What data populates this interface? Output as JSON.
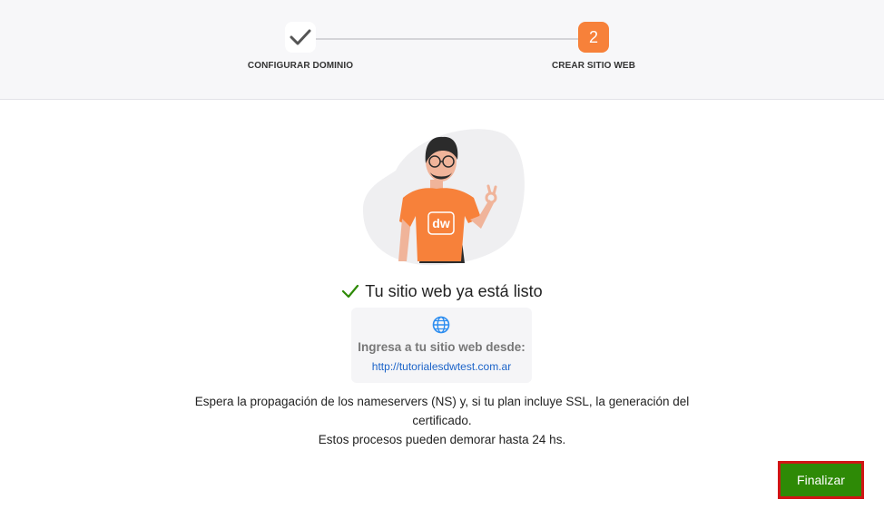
{
  "stepper": {
    "steps": [
      {
        "label": "CONFIGURAR DOMINIO",
        "state": "completed",
        "icon": "check-icon"
      },
      {
        "label": "CREAR SITIO WEB",
        "number": "2",
        "state": "active"
      }
    ],
    "accent_color": "#f7813a"
  },
  "illustration": {
    "shirt_logo": "dw",
    "icon": "developer-character-ok-gesture"
  },
  "success": {
    "title": "Tu sitio web ya está listo",
    "icon": "check-icon",
    "color": "#2e8a06"
  },
  "site_card": {
    "icon": "globe-icon",
    "label": "Ingresa a tu sitio web desde:",
    "url": "http://tutorialesdwtest.com.ar"
  },
  "note": {
    "line1": "Espera la propagación de los nameservers (NS) y, si tu plan incluye SSL, la generación del certificado.",
    "line2": "Estos procesos pueden demorar hasta 24 hs."
  },
  "actions": {
    "finalizar_label": "Finalizar",
    "button_color": "#2e8a06",
    "highlight_color": "#d11515"
  }
}
